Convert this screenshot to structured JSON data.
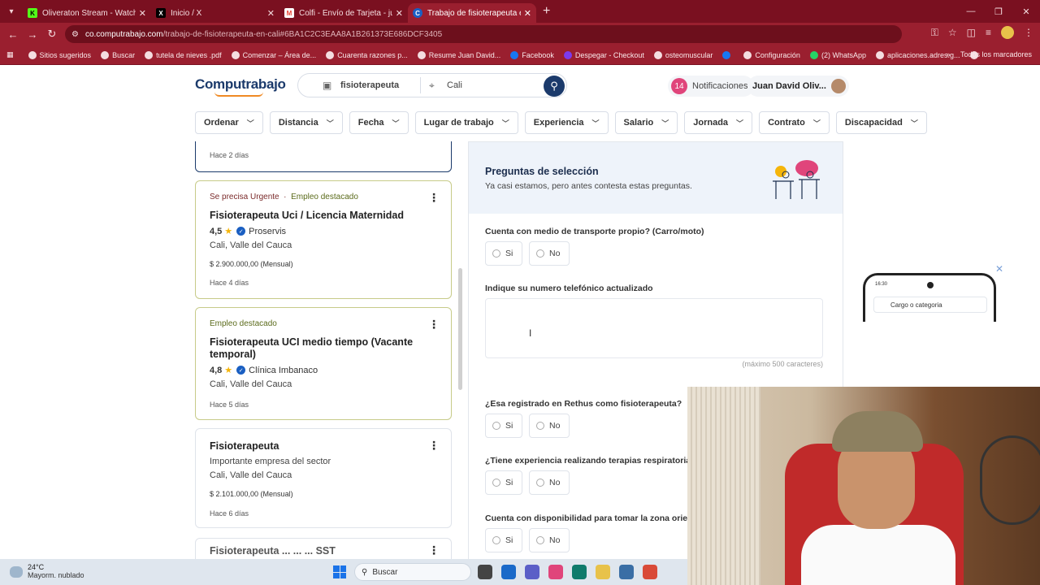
{
  "browser": {
    "tabs": [
      {
        "title": "Oliveraton Stream - Watch",
        "favicon": "K",
        "color": "#53fc18"
      },
      {
        "title": "Inicio / X",
        "favicon": "X",
        "color": "#000000"
      },
      {
        "title": "Colfi - Envío de Tarjeta - juandav",
        "favicon": "M",
        "color": "#ea4335"
      },
      {
        "title": "Trabajo de fisioterapeuta en Cali",
        "favicon": "C",
        "color": "#1a5fc2"
      }
    ],
    "url_host": "co.computrabajo.com",
    "url_path": "/trabajo-de-fisioterapeuta-en-cali#6BA1C2C3EAA8A1B261373E686DCF3405",
    "bookmarks": [
      "Sitios sugeridos",
      "Buscar",
      "tutela de nieves .pdf",
      "Comenzar – Área de...",
      "Cuarenta razones p...",
      "Resume Juan David...",
      "Facebook",
      "Despegar - Checkout",
      "osteomuscular",
      "Configuración",
      "(2) WhatsApp",
      "aplicaciones.adres.g..."
    ],
    "bookmarks_right": "Todos los marcadores"
  },
  "header": {
    "logo": "Computrabajo",
    "search_query": "fisioterapeuta",
    "search_location": "Cali",
    "notif_count": "14",
    "notif_label": "Notificaciones",
    "user_name": "Juan David Oliv..."
  },
  "filters": [
    "Ordenar",
    "Distancia",
    "Fecha",
    "Lugar de trabajo",
    "Experiencia",
    "Salario",
    "Jornada",
    "Contrato",
    "Discapacidad"
  ],
  "jobs": {
    "partial_ago": "Hace 2 días",
    "items": [
      {
        "tag_urgent": "Se precisa Urgente",
        "tag_dest": "Empleo destacado",
        "title": "Fisioterapeuta Uci / Licencia Maternidad",
        "rating": "4,5",
        "company": "Proservis",
        "location": "Cali, Valle del Cauca",
        "salary": "$ 2.900.000,00 (Mensual)",
        "ago": "Hace 4 días"
      },
      {
        "tag_dest": "Empleo destacado",
        "title": "Fisioterapeuta UCI medio tiempo (Vacante temporal)",
        "rating": "4,8",
        "company": "Clínica Imbanaco",
        "location": "Cali, Valle del Cauca",
        "ago": "Hace 5 días"
      },
      {
        "title": "Fisioterapeuta",
        "company_plain": "Importante empresa del sector",
        "location": "Cali, Valle del Cauca",
        "salary": "$ 2.101.000,00 (Mensual)",
        "ago": "Hace 6 días"
      },
      {
        "title": "Fisioterapeuta ... ... ... SST"
      }
    ]
  },
  "panel": {
    "title": "Preguntas de selección",
    "subtitle": "Ya casi estamos, pero antes contesta estas preguntas.",
    "q1": "Cuenta con medio de transporte propio? (Carro/moto)",
    "q2": "Indique su numero telefónico actualizado",
    "q2_counter": "(máximo 500 caracteres)",
    "q3": "¿Esa registrado en Rethus como fisioterapeuta?",
    "q4": "¿Tiene experiencia realizando terapias respiratorias?",
    "q5": "Cuenta con disponibilidad para tomar la zona oriente",
    "yes": "Si",
    "no": "No"
  },
  "phone": {
    "time": "16:30",
    "category": "Cargo o categoria"
  },
  "taskbar": {
    "temp": "24°C",
    "condition": "Mayorm. nublado",
    "search": "Buscar"
  }
}
